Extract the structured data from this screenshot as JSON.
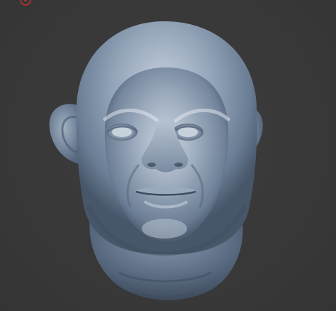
{
  "viewport": {
    "background": "#3a3a3a",
    "model": {
      "subject": "sculpted-head",
      "material_color": "#7f92a8",
      "highlight_color": "#c3cfdc",
      "shadow_color": "#2f3a4a"
    },
    "gizmo": {
      "icon": "axis-gizmo-icon",
      "color": "#c0392b"
    }
  }
}
